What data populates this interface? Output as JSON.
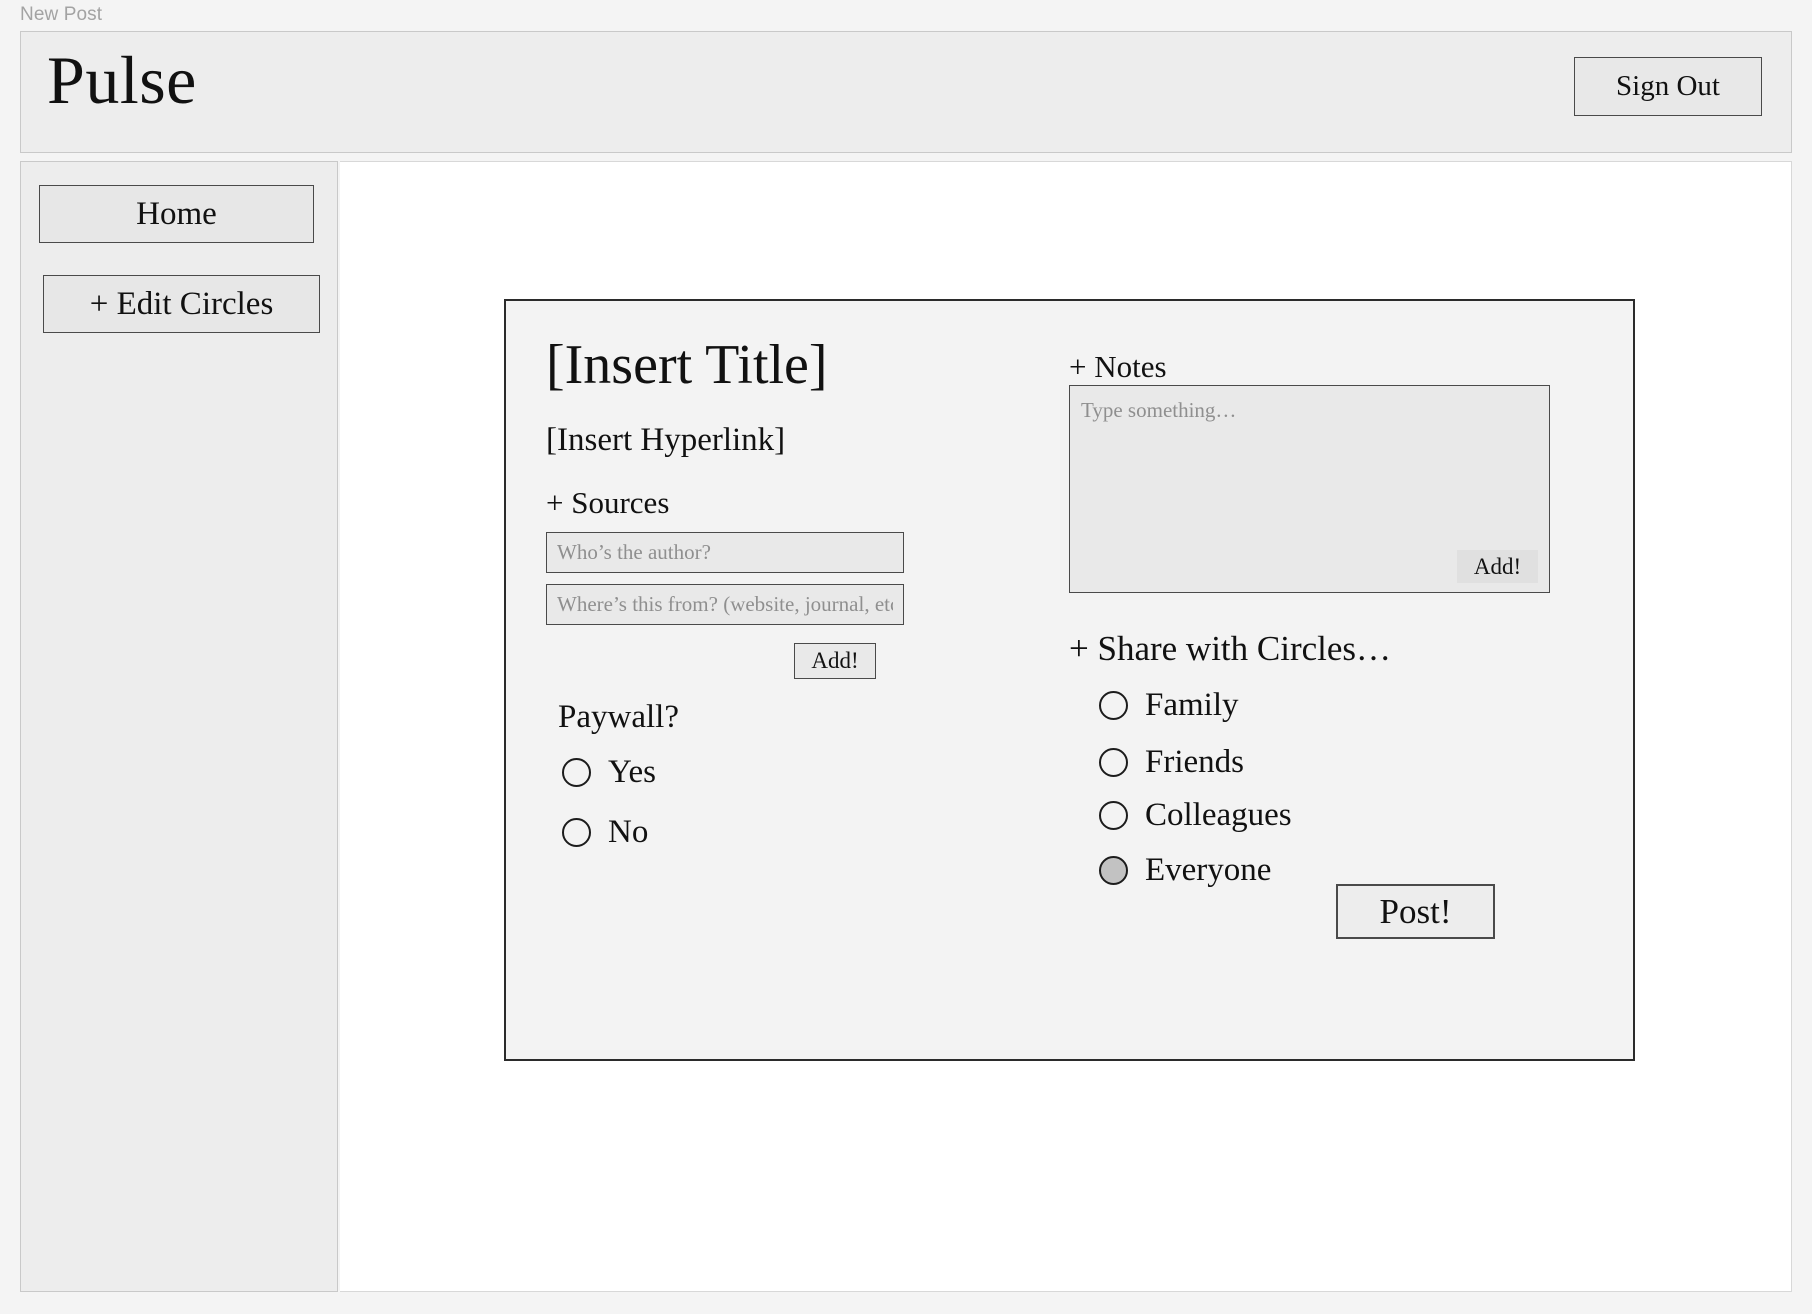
{
  "window": {
    "label": "New Post"
  },
  "header": {
    "brand": "Pulse",
    "sign_out_label": "Sign Out"
  },
  "sidebar": {
    "items": [
      {
        "label": "Home"
      },
      {
        "label": "+ Edit Circles"
      }
    ]
  },
  "composer": {
    "title": "[Insert Title]",
    "hyperlink": "[Insert Hyperlink]",
    "sources": {
      "heading": "+ Sources",
      "author_placeholder": "Who’s the author?",
      "author_value": "",
      "source_placeholder": "Where’s this from? (website, journal, etc.)",
      "source_value": "",
      "add_label": "Add!"
    },
    "paywall": {
      "heading": "Paywall?",
      "options": [
        {
          "label": "Yes",
          "selected": false
        },
        {
          "label": "No",
          "selected": false
        }
      ]
    },
    "notes": {
      "heading": "+ Notes",
      "placeholder": "Type something…",
      "value": "",
      "add_label": "Add!"
    },
    "circles": {
      "heading": "+ Share with Circles…",
      "options": [
        {
          "label": "Family",
          "selected": false
        },
        {
          "label": "Friends",
          "selected": false
        },
        {
          "label": "Colleagues",
          "selected": false
        },
        {
          "label": "Everyone",
          "selected": true
        }
      ]
    },
    "post_label": "Post!"
  },
  "colors": {
    "page_background": "#f4f4f4",
    "panel_background": "#ededed",
    "card_background": "#f3f3f3",
    "content_background": "#ffffff",
    "field_background": "#e9e9e9",
    "border_dark": "#4a4a4a",
    "border_light": "#c9c9c9",
    "text": "#111111",
    "placeholder_text": "#8f8f8f",
    "window_label_text": "#a3a3a3",
    "radio_selected_fill": "#c2c2c2"
  }
}
